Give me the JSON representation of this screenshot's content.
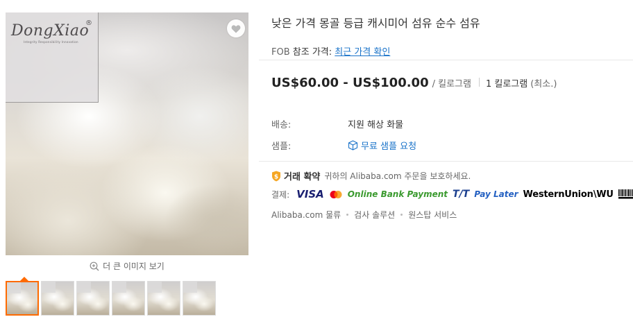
{
  "product": {
    "title": "낮은 가격 몽골 등급 캐시미어 섬유 순수 섬유",
    "logo_text": "DongXiao",
    "logo_reg": "®",
    "logo_tagline": "Integrity Responsibility Innovation"
  },
  "gallery": {
    "view_larger_label": "더 큰 이미지 보기",
    "thumbnail_count": 6,
    "active_thumbnail": 1
  },
  "pricing": {
    "fob_prefix": "FOB",
    "fob_ref_label": "참조 가격:",
    "fob_link": "최근 가격 확인",
    "price_range": "US$60.00 - US$100.00",
    "price_unit": "/ 킬로그램",
    "moq": "1 킬로그램",
    "moq_note": "(최소.)"
  },
  "shipping": {
    "label": "배송:",
    "value": "지원 해상 화물"
  },
  "samples": {
    "label": "샘플:",
    "link": "무료 샘플 요청"
  },
  "trade_assurance": {
    "title": "거래 확약",
    "description": "귀하의 Alibaba.com 주문을 보호하세요."
  },
  "payment": {
    "label": "결제:",
    "visa": "VISA",
    "online_bank": "Online Bank Payment",
    "tt": "T/T",
    "pay_later": "Pay Later",
    "western_union": "WesternUnion\\WU"
  },
  "services": {
    "logistics": "Alibaba.com 물류",
    "inspection": "검사 솔루션",
    "one_stop": "원스탑 서비스"
  },
  "colors": {
    "accent": "#ff6a00",
    "link": "#1a73c9",
    "trade_assurance_shield": "#f5a623"
  }
}
